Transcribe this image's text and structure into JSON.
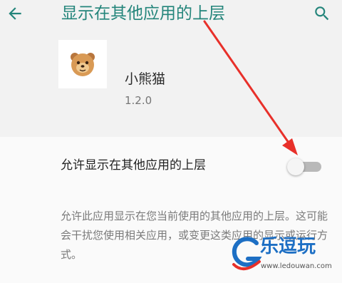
{
  "app_bar": {
    "title": "显示在其他应用的上层",
    "back_icon": "arrow-back-icon",
    "search_icon": "search-icon"
  },
  "app_info": {
    "name": "小熊猫",
    "version": "1.2.0",
    "icon": "bear-face-icon"
  },
  "permission": {
    "label": "允许显示在其他应用的上层",
    "enabled": false
  },
  "description": "允许此应用显示在您当前使用的其他应用的上层。这可能会干扰您使用相关应用，或变更这类应用的显示或运行方式。",
  "watermark": {
    "title": "乐逗玩",
    "url": "www.ledouwan.com"
  },
  "colors": {
    "accent": "#24857b",
    "annotation": "#e8302a",
    "watermark": "#1d6fc4"
  }
}
